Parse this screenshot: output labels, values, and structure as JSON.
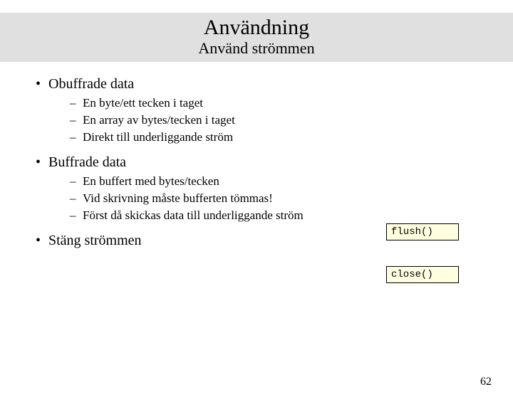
{
  "header": {
    "title": "Användning",
    "subtitle": "Använd strömmen"
  },
  "bullets": {
    "b1": "Obuffrade data",
    "b1_items": [
      "En byte/ett tecken i taget",
      "En array av bytes/tecken i taget",
      "Direkt till underliggande ström"
    ],
    "b2": "Buffrade data",
    "b2_items": [
      "En buffert med bytes/tecken",
      "Vid skrivning måste bufferten tömmas!",
      "Först då skickas data till underliggande ström"
    ],
    "b3": "Stäng strömmen"
  },
  "code_boxes": {
    "flush": "flush()",
    "close": "close()"
  },
  "page_number": "62"
}
